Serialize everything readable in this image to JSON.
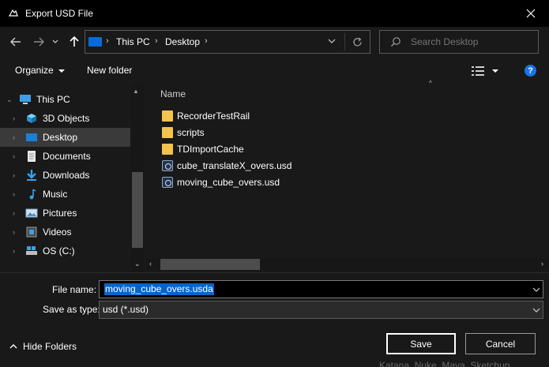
{
  "window": {
    "title": "Export USD File"
  },
  "address": {
    "segments": [
      "This PC",
      "Desktop"
    ]
  },
  "search": {
    "placeholder": "Search Desktop"
  },
  "toolbar": {
    "organize_label": "Organize",
    "new_folder_label": "New folder",
    "help_label": "?"
  },
  "nav": {
    "items": [
      {
        "label": "This PC",
        "icon": "computer-icon",
        "selected": false
      },
      {
        "label": "3D Objects",
        "icon": "cube-icon",
        "selected": false
      },
      {
        "label": "Desktop",
        "icon": "desktop-icon",
        "selected": true
      },
      {
        "label": "Documents",
        "icon": "document-icon",
        "selected": false
      },
      {
        "label": "Downloads",
        "icon": "download-icon",
        "selected": false
      },
      {
        "label": "Music",
        "icon": "music-icon",
        "selected": false
      },
      {
        "label": "Pictures",
        "icon": "pictures-icon",
        "selected": false
      },
      {
        "label": "Videos",
        "icon": "video-icon",
        "selected": false
      },
      {
        "label": "OS (C:)",
        "icon": "drive-icon",
        "selected": false
      }
    ]
  },
  "files": {
    "column_name": "Name",
    "items": [
      {
        "name": "RecorderTestRail",
        "type": "folder"
      },
      {
        "name": "scripts",
        "type": "folder"
      },
      {
        "name": "TDImportCache",
        "type": "folder"
      },
      {
        "name": "cube_translateX_overs.usd",
        "type": "usd"
      },
      {
        "name": "moving_cube_overs.usd",
        "type": "usd"
      }
    ]
  },
  "form": {
    "filename_label": "File name:",
    "filename_value": "moving_cube_overs.usda",
    "type_label": "Save as type:",
    "type_value": "usd (*.usd)"
  },
  "actions": {
    "hide_folders_label": "Hide Folders",
    "save_label": "Save",
    "cancel_label": "Cancel"
  },
  "background_text": "Katana, Nuke, Maya, Sketchup",
  "colors": {
    "accent": "#0a64c8",
    "folder": "#f3c44c",
    "help": "#1a73e8"
  }
}
